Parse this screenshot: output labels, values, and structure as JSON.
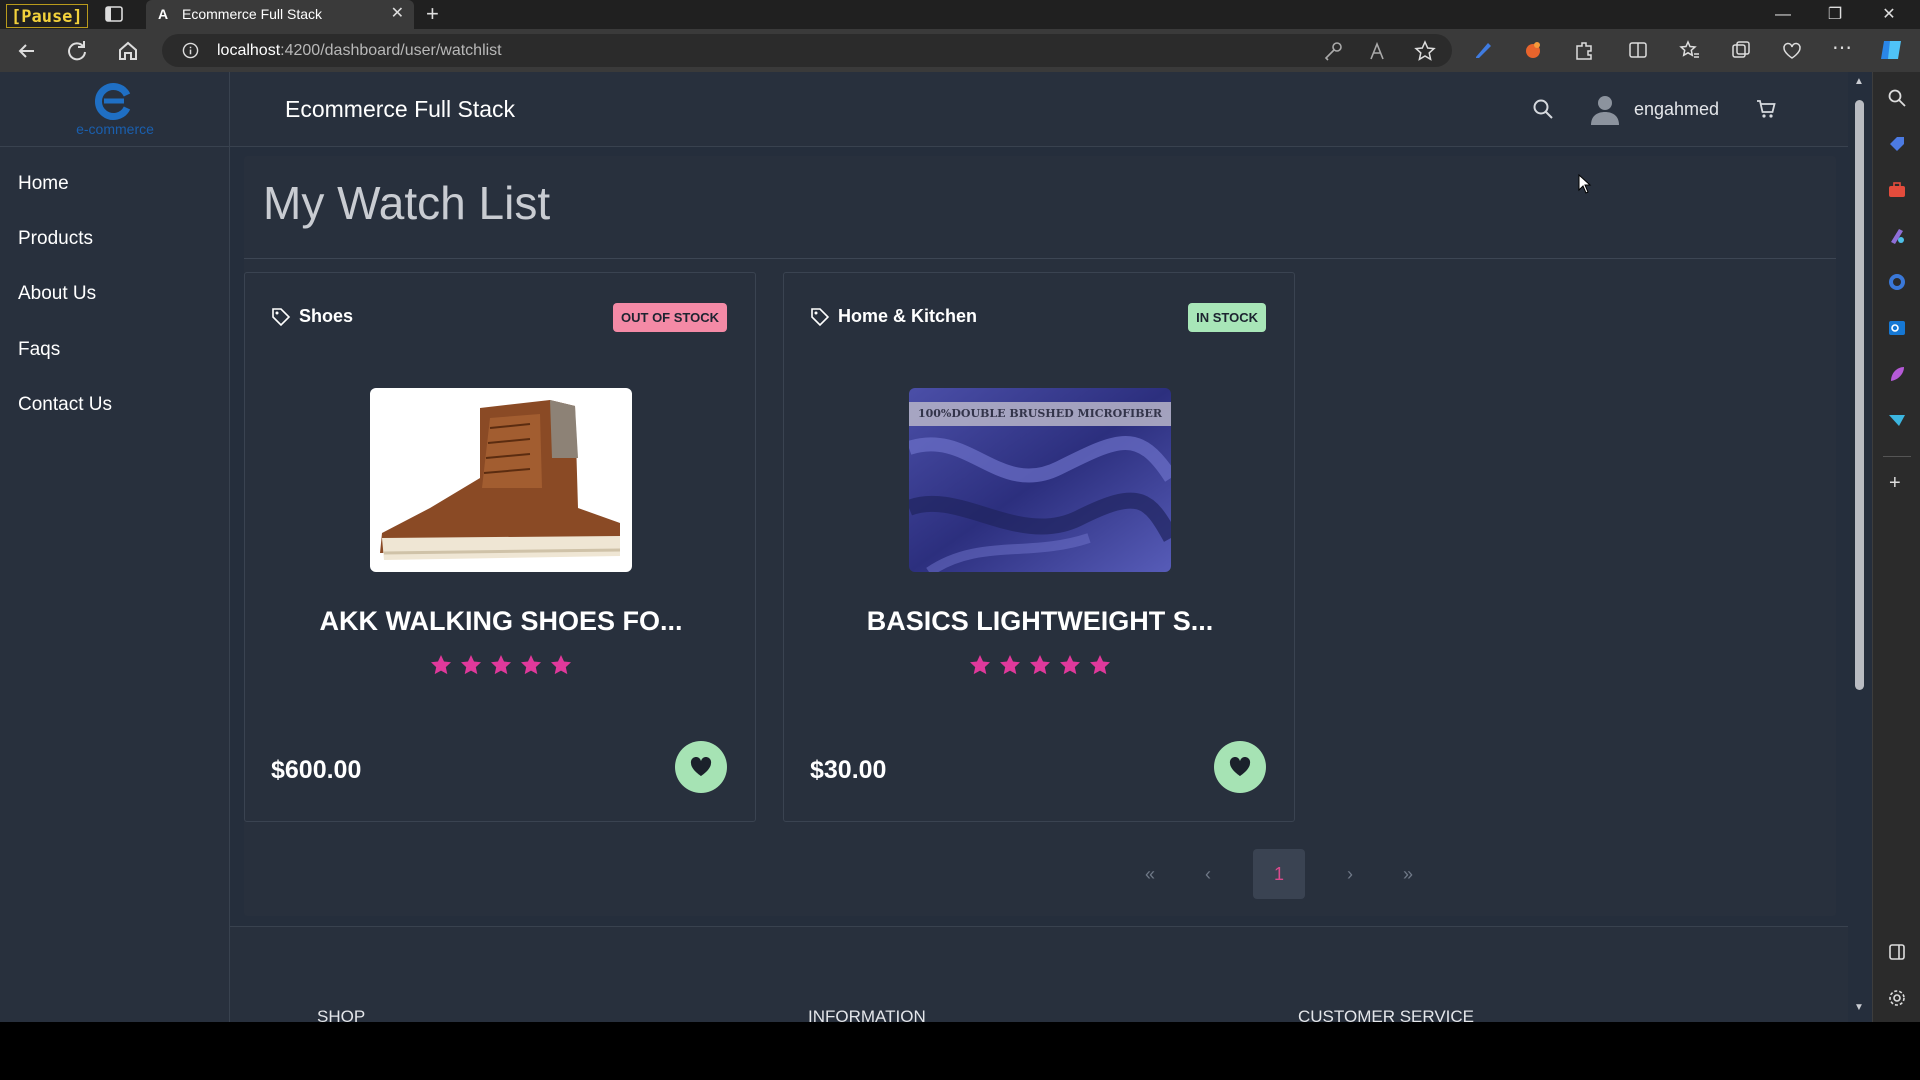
{
  "browser": {
    "pause_label": "[Pause]",
    "tab_title": "Ecommerce Full Stack",
    "url_host": "localhost",
    "url_path": ":4200/dashboard/user/watchlist"
  },
  "app": {
    "brand": "Ecommerce Full Stack",
    "logo_text": "e-commerce",
    "username": "engahmed",
    "nav": [
      "Home",
      "Products",
      "About Us",
      "Faqs",
      "Contact Us"
    ],
    "page_title": "My Watch List",
    "products": [
      {
        "category": "Shoes",
        "stock": "OUT OF STOCK",
        "name": "AKK WALKING SHOES FO...",
        "rating": 5,
        "price": "$600.00",
        "image": "brown-leather-boot"
      },
      {
        "category": "Home & Kitchen",
        "stock": "IN STOCK",
        "name": "BASICS LIGHTWEIGHT S...",
        "rating": 5,
        "price": "$30.00",
        "image": "blue-microfiber-sheet",
        "image_caption": "100%DOUBLE BRUSHED MICROFIBER"
      }
    ],
    "pagination": {
      "current": "1",
      "first": "«",
      "prev": "‹",
      "next": "›",
      "last": "»"
    },
    "footer": [
      "SHOP",
      "INFORMATION",
      "CUSTOMER SERVICE"
    ]
  },
  "colors": {
    "background": "#252e3c",
    "panel": "#28303d",
    "star": "#e0399b",
    "out_of_stock": "#f48aa6",
    "in_stock": "#a8e6b8"
  }
}
